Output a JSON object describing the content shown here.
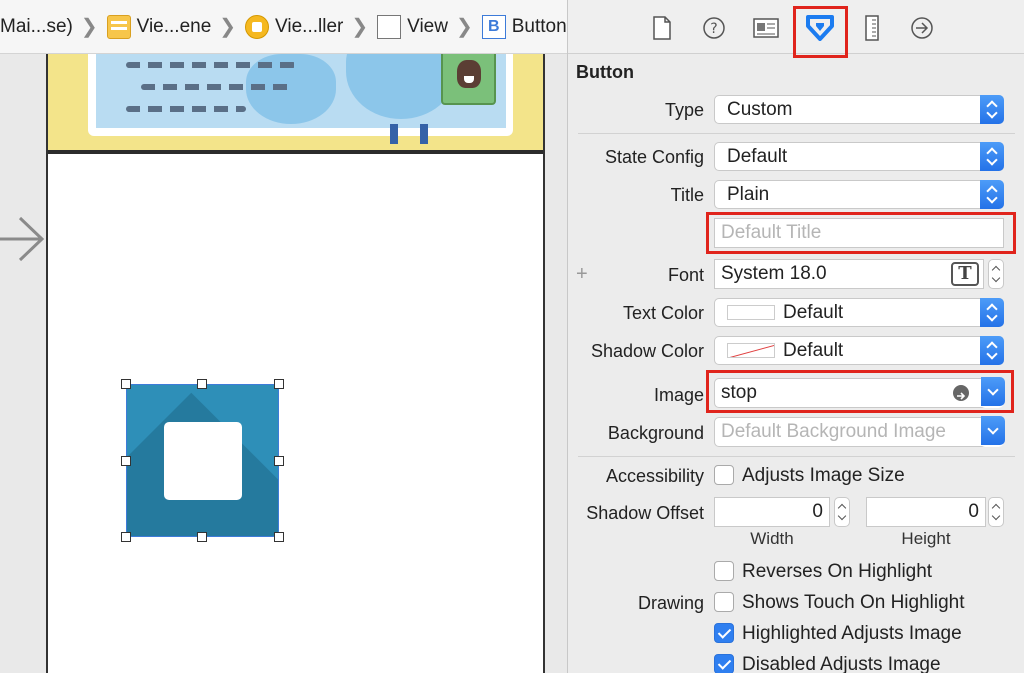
{
  "breadcrumb": {
    "items": [
      {
        "label": "Mai...se)",
        "icon": "none"
      },
      {
        "label": "Vie...ene",
        "icon": "storyboard-scene-icon"
      },
      {
        "label": "Vie...ller",
        "icon": "view-controller-icon"
      },
      {
        "label": "View",
        "icon": "view-icon"
      },
      {
        "label": "Button",
        "icon": "button-b-icon"
      }
    ],
    "button_icon_letter": "B"
  },
  "inspector": {
    "tabs": [
      "file-inspector-icon",
      "quick-help-icon",
      "identity-inspector-icon",
      "attributes-inspector-icon",
      "size-inspector-icon",
      "connections-inspector-icon"
    ],
    "selected_tab": "attributes-inspector-icon",
    "section_title": "Button",
    "type": {
      "label": "Type",
      "value": "Custom"
    },
    "state_config": {
      "label": "State Config",
      "value": "Default"
    },
    "title": {
      "label": "Title",
      "value": "Plain"
    },
    "title_field": {
      "placeholder": "Default Title"
    },
    "font": {
      "label": "Font",
      "value": "System 18.0",
      "add_symbol": "+",
      "font_picker_glyph": "T"
    },
    "text_color": {
      "label": "Text Color",
      "value": "Default"
    },
    "shadow_color": {
      "label": "Shadow Color",
      "value": "Default"
    },
    "image": {
      "label": "Image",
      "value": "stop"
    },
    "background": {
      "label": "Background",
      "placeholder": "Default Background Image"
    },
    "accessibility": {
      "label": "Accessibility",
      "option": "Adjusts Image Size",
      "checked": false
    },
    "shadow_offset": {
      "label": "Shadow Offset",
      "width": "0",
      "height": "0",
      "width_label": "Width",
      "height_label": "Height"
    },
    "drawing": {
      "label": "Drawing",
      "options": [
        {
          "label": "Reverses On Highlight",
          "checked": false
        },
        {
          "label": "Shows Touch On Highlight",
          "checked": false
        },
        {
          "label": "Highlighted Adjusts Image",
          "checked": true
        },
        {
          "label": "Disabled Adjusts Image",
          "checked": true
        }
      ]
    }
  },
  "colors": {
    "highlight_box": "#e0241c",
    "accent_blue": "#2f7ff0",
    "button_fill": "#2e8fb8"
  }
}
